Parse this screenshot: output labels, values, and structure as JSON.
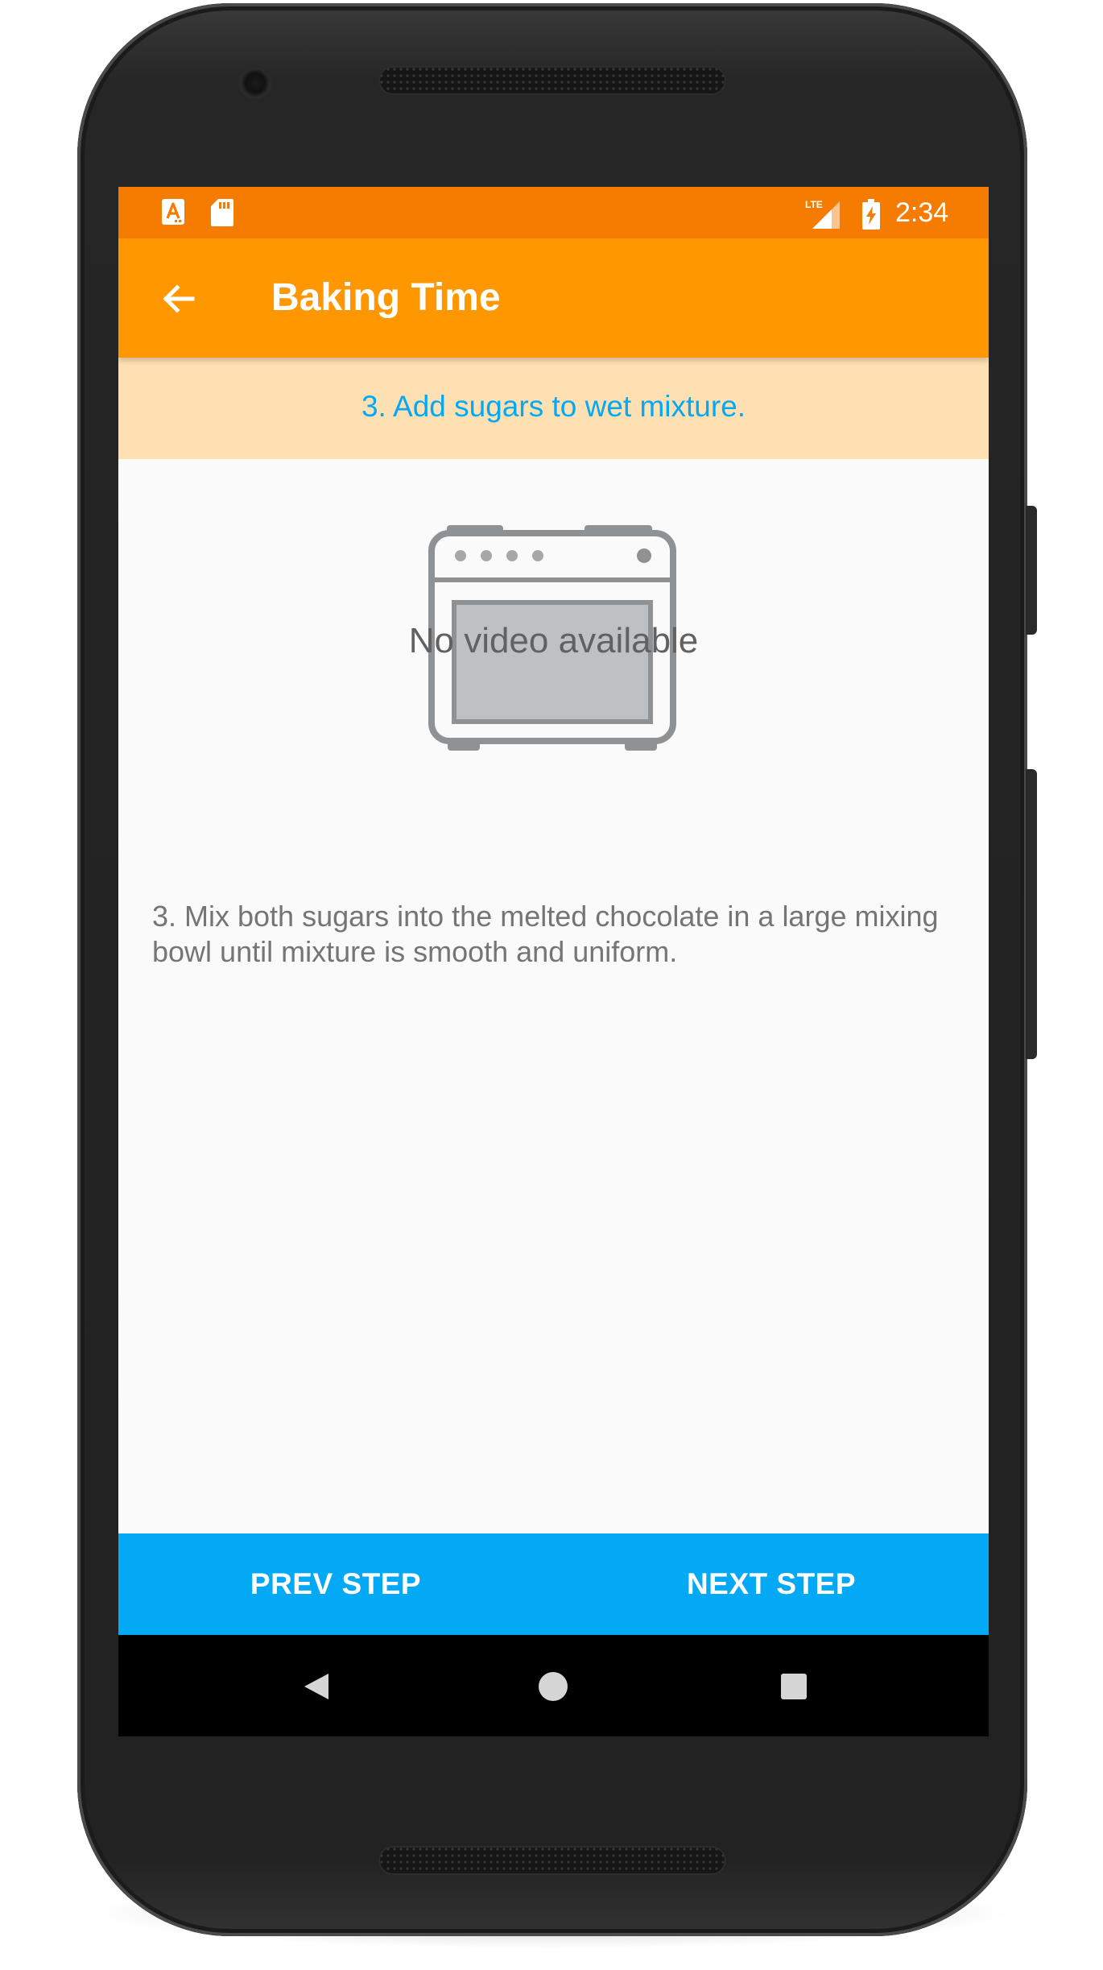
{
  "status_bar": {
    "time": "2:34",
    "icons": [
      "a-notification-icon",
      "sd-card-icon",
      "lte-signal-icon",
      "battery-charging-icon"
    ]
  },
  "app_bar": {
    "title": "Baking Time",
    "back_icon": "arrow-left-icon"
  },
  "step": {
    "header": "3. Add sugars to wet mixture.",
    "media_placeholder_text": "No video available",
    "media_icon": "oven-icon",
    "description": "3. Mix both sugars into the melted chocolate in a large mixing bowl until mixture is smooth and uniform."
  },
  "step_nav": {
    "prev_label": "PREV STEP",
    "next_label": "NEXT STEP"
  },
  "system_nav": {
    "icons": [
      "back-triangle-icon",
      "home-circle-icon",
      "recents-square-icon"
    ]
  },
  "colors": {
    "status_bar": "#f57c00",
    "app_bar": "#ff9800",
    "step_header_bg": "#ffe0b2",
    "accent": "#03a9f4",
    "body_text": "#757575"
  }
}
